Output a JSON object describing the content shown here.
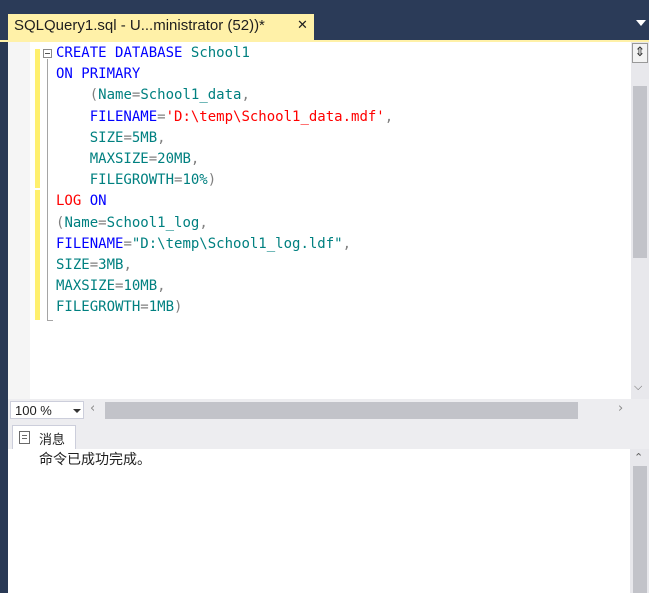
{
  "document_tab": {
    "title": "SQLQuery1.sql - U...ministrator (52))*",
    "close_glyph": "✕"
  },
  "editor": {
    "lines": [
      [
        {
          "t": "CREATE",
          "c": "kw"
        },
        {
          "t": " "
        },
        {
          "t": "DATABASE",
          "c": "kw"
        },
        {
          "t": " "
        },
        {
          "t": "School1",
          "c": "tx"
        }
      ],
      [
        {
          "t": "ON",
          "c": "kw"
        },
        {
          "t": " "
        },
        {
          "t": "PRIMARY",
          "c": "kw"
        }
      ],
      [
        {
          "t": "    "
        },
        {
          "t": "(",
          "c": "pn"
        },
        {
          "t": "Name",
          "c": "tx"
        },
        {
          "t": "=",
          "c": "pn"
        },
        {
          "t": "School1_data",
          "c": "tx"
        },
        {
          "t": ",",
          "c": "pn"
        }
      ],
      [
        {
          "t": "    "
        },
        {
          "t": "FILENAME",
          "c": "kw"
        },
        {
          "t": "=",
          "c": "pn"
        },
        {
          "t": "'D:\\temp\\School1_data.mdf'",
          "c": "st"
        },
        {
          "t": ",",
          "c": "pn"
        }
      ],
      [
        {
          "t": "    "
        },
        {
          "t": "SIZE",
          "c": "tx"
        },
        {
          "t": "=",
          "c": "pn"
        },
        {
          "t": "5MB",
          "c": "tx"
        },
        {
          "t": ",",
          "c": "pn"
        }
      ],
      [
        {
          "t": "    "
        },
        {
          "t": "MAXSIZE",
          "c": "tx"
        },
        {
          "t": "=",
          "c": "pn"
        },
        {
          "t": "20MB",
          "c": "tx"
        },
        {
          "t": ",",
          "c": "pn"
        }
      ],
      [
        {
          "t": "    "
        },
        {
          "t": "FILEGROWTH",
          "c": "tx"
        },
        {
          "t": "=",
          "c": "pn"
        },
        {
          "t": "10%",
          "c": "tx"
        },
        {
          "t": ")",
          "c": "pn"
        }
      ],
      [
        {
          "t": "LOG",
          "c": "st"
        },
        {
          "t": " "
        },
        {
          "t": "ON",
          "c": "kw"
        }
      ],
      [
        {
          "t": "(",
          "c": "pn"
        },
        {
          "t": "Name",
          "c": "tx"
        },
        {
          "t": "=",
          "c": "pn"
        },
        {
          "t": "School1_log",
          "c": "tx"
        },
        {
          "t": ",",
          "c": "pn"
        }
      ],
      [
        {
          "t": "FILENAME",
          "c": "kw"
        },
        {
          "t": "=",
          "c": "pn"
        },
        {
          "t": "\"D:\\temp\\School1_log.ldf\"",
          "c": "tx"
        },
        {
          "t": ",",
          "c": "pn"
        }
      ],
      [
        {
          "t": "SIZE",
          "c": "tx"
        },
        {
          "t": "=",
          "c": "pn"
        },
        {
          "t": "3MB",
          "c": "tx"
        },
        {
          "t": ",",
          "c": "pn"
        }
      ],
      [
        {
          "t": "MAXSIZE",
          "c": "tx"
        },
        {
          "t": "=",
          "c": "pn"
        },
        {
          "t": "10MB",
          "c": "tx"
        },
        {
          "t": ",",
          "c": "pn"
        }
      ],
      [
        {
          "t": "FILEGROWTH",
          "c": "tx"
        },
        {
          "t": "=",
          "c": "pn"
        },
        {
          "t": "1MB",
          "c": "tx"
        },
        {
          "t": ")",
          "c": "pn"
        }
      ]
    ]
  },
  "zoom": {
    "value": "100 %"
  },
  "results": {
    "tab_label": "消息",
    "message": "命令已成功完成。"
  },
  "colors": {
    "keyword": "#0000ff",
    "identifier": "#008080",
    "string": "#ff0000",
    "punctuation": "#808080",
    "active_tab": "#fff1a8",
    "change_margin": "#fff06e",
    "frame": "#293955"
  },
  "icons": {
    "tab_close": "close-icon",
    "tab_list": "chevron-down-icon",
    "split": "split-window-icon",
    "messages": "message-document-icon"
  }
}
